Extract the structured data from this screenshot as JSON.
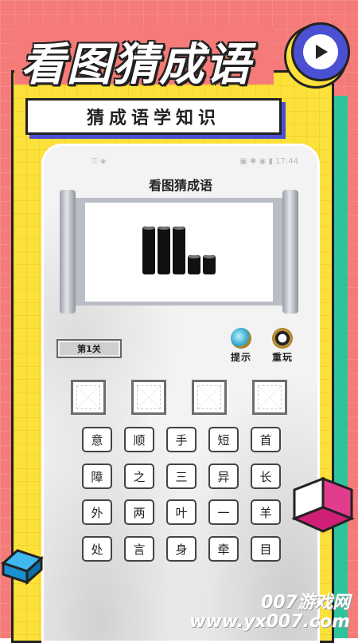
{
  "promo": {
    "title": "看图猜成语",
    "subtitle": "猜成语学知识",
    "watermark": "007游戏网\nwww.yx007.com"
  },
  "statusbar": {
    "left": "⚿ ◈",
    "right": "▣ ✱ ◉ ▮ 17:44"
  },
  "game": {
    "title": "看图猜成语",
    "level": "第1关",
    "hint_label": "提示",
    "replay_label": "重玩",
    "answer_slots": [
      "",
      "",
      "",
      ""
    ],
    "keyboard": [
      [
        "意",
        "顺",
        "手",
        "短",
        "首"
      ],
      [
        "障",
        "之",
        "三",
        "异",
        "长"
      ],
      [
        "外",
        "两",
        "叶",
        "一",
        "羊"
      ],
      [
        "处",
        "言",
        "身",
        "牵",
        "目"
      ]
    ],
    "puzzle_image": {
      "icon": "bars-image",
      "bar_heights": [
        3,
        3,
        3,
        1,
        1
      ]
    }
  },
  "colors": {
    "background": "#f47b78",
    "panel": "#fde13b",
    "accent_blue": "#4a50d1",
    "accent_green": "#2fc39d"
  }
}
